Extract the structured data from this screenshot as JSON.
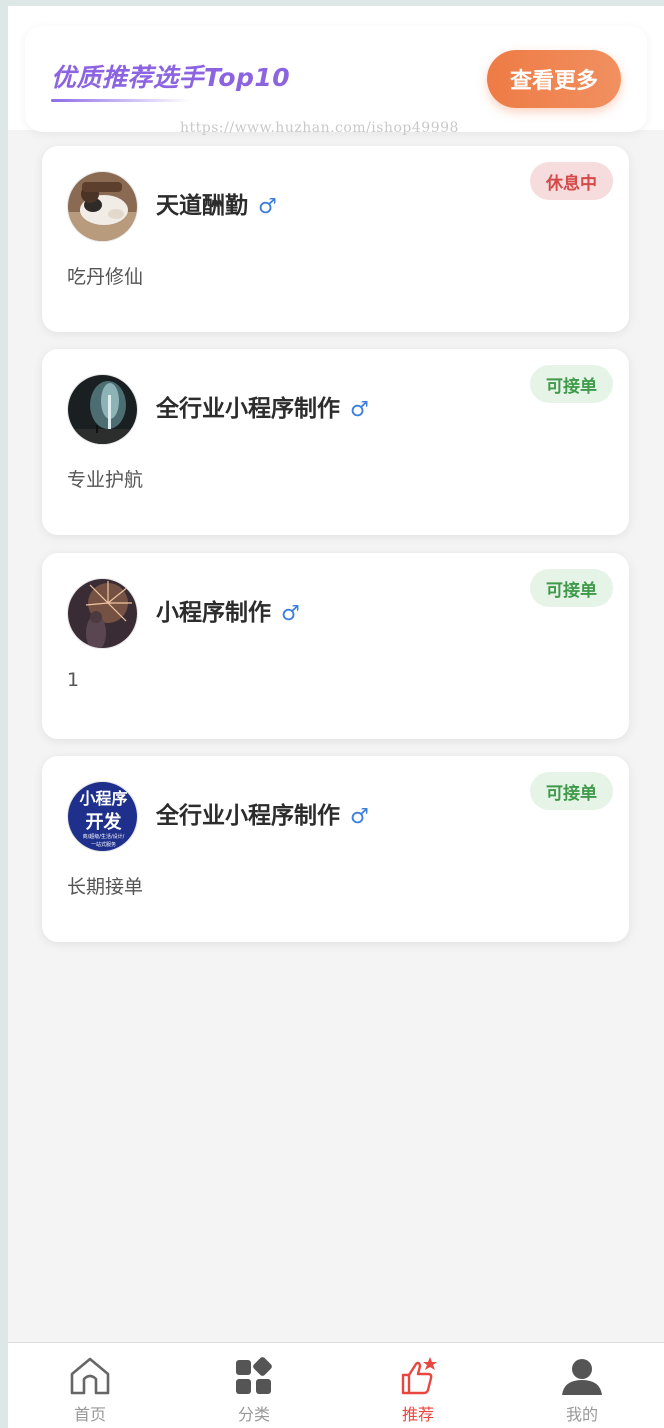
{
  "header": {
    "title": "优质推荐选手Top10",
    "more_button": "查看更多",
    "watermark": "https://www.huzhan.com/ishop49998"
  },
  "players": [
    {
      "name": "天道酬勤",
      "gender": "♂",
      "desc": "吃丹修仙",
      "status": "休息中",
      "status_color": "#d44a4a",
      "status_bg": "#f6dcdc"
    },
    {
      "name": "全行业小程序制作",
      "gender": "♂",
      "desc": "专业护航",
      "status": "可接单",
      "status_color": "#3f9a4a",
      "status_bg": "#e6f4e8"
    },
    {
      "name": "小程序制作",
      "gender": "♂",
      "desc": "1",
      "status": "可接单",
      "status_color": "#3f9a4a",
      "status_bg": "#e6f4e8"
    },
    {
      "name": "全行业小程序制作",
      "gender": "♂",
      "desc": "长期接单",
      "status": "可接单",
      "status_color": "#3f9a4a",
      "status_bg": "#e6f4e8",
      "avatar_text": {
        "line1": "小程序",
        "line2": "开发",
        "line3": "商/超级/生活/设计/",
        "line4": "一站式服务"
      }
    }
  ],
  "tabbar": {
    "items": [
      {
        "label": "首页",
        "icon": "home-icon"
      },
      {
        "label": "分类",
        "icon": "category-icon"
      },
      {
        "label": "推荐",
        "icon": "thumbs-up-icon"
      },
      {
        "label": "我的",
        "icon": "user-icon"
      }
    ],
    "active_index": 2,
    "active_color": "#e8473f"
  }
}
